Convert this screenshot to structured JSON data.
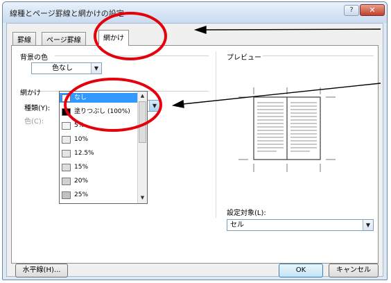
{
  "window": {
    "title": "線種とページ罫線と網かけの設定",
    "help": "?",
    "close": "✕"
  },
  "tabs": [
    {
      "label": "罫線"
    },
    {
      "label": "ページ罫線"
    },
    {
      "label": "網かけ"
    }
  ],
  "background": {
    "label": "背景の色",
    "value": "色なし"
  },
  "shading": {
    "group_label": "網かけ",
    "type_label": "種類(Y):",
    "type_value": "なし",
    "color_label": "色(C):"
  },
  "pattern_options": [
    {
      "label": "なし",
      "swatch": "#ffffff"
    },
    {
      "label": "塗りつぶし (100%)",
      "swatch": "#000000"
    },
    {
      "label": "5%",
      "swatch": "#f4f4f4"
    },
    {
      "label": "10%",
      "swatch": "#ececec"
    },
    {
      "label": "12.5%",
      "swatch": "#e4e4e4"
    },
    {
      "label": "15%",
      "swatch": "#dddddd"
    },
    {
      "label": "20%",
      "swatch": "#d0d0d0"
    },
    {
      "label": "25%",
      "swatch": "#c2c2c2"
    }
  ],
  "preview": {
    "label": "プレビュー",
    "apply_label": "設定対象(L):",
    "apply_value": "セル"
  },
  "buttons": {
    "horizontal_line": "水平線(H)...",
    "ok": "OK",
    "cancel": "キャンセル"
  },
  "colors": {
    "annotation": "#e5000b",
    "selection": "#3399ff"
  }
}
